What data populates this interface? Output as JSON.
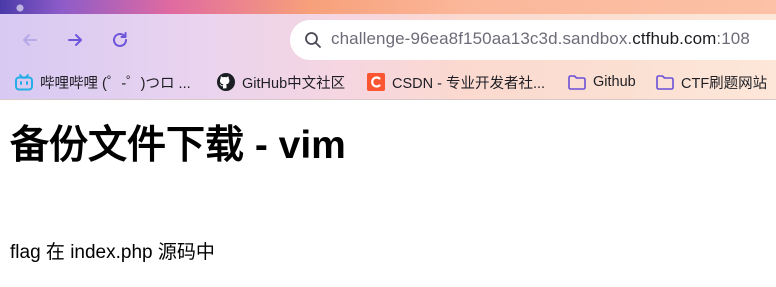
{
  "browser": {
    "address": {
      "url_prefix": "challenge-96ea8f150aa13c3d.sandbox.",
      "url_host": "ctfhub.com",
      "url_suffix": ":108"
    },
    "bookmarks": [
      {
        "label": "哔哩哔哩 (゜-゜)つロ ...",
        "icon": "bilibili-icon"
      },
      {
        "label": "GitHub中文社区",
        "icon": "github-icon"
      },
      {
        "label": "CSDN - 专业开发者社...",
        "icon": "csdn-icon"
      },
      {
        "label": "Github",
        "icon": "folder-icon"
      },
      {
        "label": "CTF刷题网站",
        "icon": "folder-icon"
      }
    ],
    "colors": {
      "bilibili": "#23ade5",
      "csdn": "#fc5531",
      "folder": "#6b4fd8",
      "nav_icon": "#6c55d9"
    }
  },
  "page": {
    "heading": "备份文件下载 - vim",
    "paragraph": "flag 在 index.php 源码中"
  }
}
